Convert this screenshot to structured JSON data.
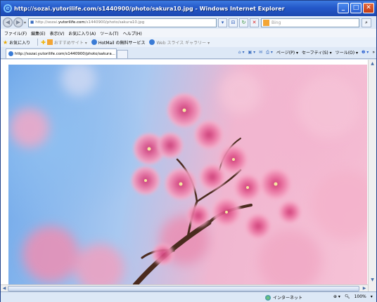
{
  "window": {
    "title": "http://sozai.yutorilife.com/s1440900/photo/sakura10.jpg - Windows Internet Explorer",
    "controls": {
      "minimize": "_",
      "maximize": "□",
      "close": "✕"
    }
  },
  "address": {
    "url_prefix": "http://sozai.",
    "url_domain": "yutorilife.com",
    "url_suffix": "/s1440900/photo/sakura10.jpg",
    "search_placeholder": "Bing"
  },
  "menu": {
    "items": [
      "ファイル(F)",
      "編集(E)",
      "表示(V)",
      "お気に入り(A)",
      "ツール(T)",
      "ヘルプ(H)"
    ]
  },
  "favorites": {
    "label": "お気に入り",
    "items": [
      {
        "label": "おすすめサイト ▾",
        "dim": true
      },
      {
        "label": "HotMail の無料サービス",
        "dim": false
      },
      {
        "label": "Web スライス ギャラリー ▾",
        "dim": true
      }
    ]
  },
  "tabs": {
    "active_label": "http://sozai.yutorilife.com/s1440900/photo/sakura..."
  },
  "commandbar": {
    "page_label": "ページ(P) ▾",
    "safety_label": "セーフティ(S) ▾",
    "tools_label": "ツール(O) ▾",
    "help_label": "❷ ▾"
  },
  "status": {
    "zone_label": "インターネット",
    "zoom_label": "100%"
  },
  "colors": {
    "titlebar": "#2458c9",
    "blossom_pink": "#e8689a",
    "sky_blue": "#6fa8ea",
    "branch": "#4a2a1e"
  }
}
